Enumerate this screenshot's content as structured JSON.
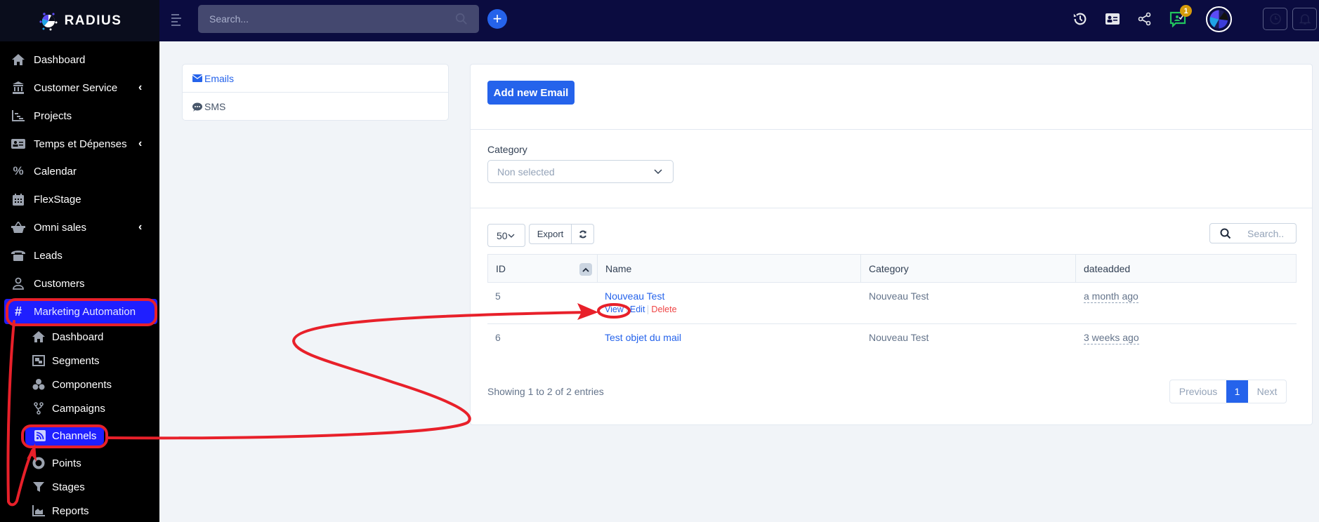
{
  "header": {
    "brand": "RADIUS",
    "search_placeholder": "Search...",
    "notification_count": "1",
    "icons": [
      "menu-toggle-icon",
      "search-icon",
      "plus-icon",
      "history-icon",
      "id-card-icon",
      "share-icon",
      "chat-check-icon",
      "avatar",
      "clock-icon",
      "bell-icon"
    ]
  },
  "sidebar": {
    "items": [
      {
        "label": "Dashboard",
        "icon": "home-icon"
      },
      {
        "label": "Customer Service",
        "icon": "bank-icon",
        "chevron": "‹"
      },
      {
        "label": "Projects",
        "icon": "chart-icon"
      },
      {
        "label": "Temps et Dépenses",
        "icon": "id-card-icon",
        "chevron": "‹"
      },
      {
        "label": "Calendar",
        "icon": "percent-icon"
      },
      {
        "label": "FlexStage",
        "icon": "calendar-icon"
      },
      {
        "label": "Omni sales",
        "icon": "basket-icon",
        "chevron": "‹"
      },
      {
        "label": "Leads",
        "icon": "phone-icon"
      },
      {
        "label": "Customers",
        "icon": "user-icon"
      },
      {
        "label": "Marketing Automation",
        "icon": "hashtag-icon",
        "active": true
      }
    ],
    "sub_items": [
      {
        "label": "Dashboard",
        "icon": "home-icon"
      },
      {
        "label": "Segments",
        "icon": "segments-icon"
      },
      {
        "label": "Components",
        "icon": "cubes-icon"
      },
      {
        "label": "Campaigns",
        "icon": "fork-icon"
      },
      {
        "label": "Channels",
        "icon": "rss-icon",
        "active": true
      },
      {
        "label": "Points",
        "icon": "circle-icon"
      },
      {
        "label": "Stages",
        "icon": "filter-icon"
      },
      {
        "label": "Reports",
        "icon": "area-chart-icon"
      }
    ]
  },
  "channels_menu": {
    "emails": "Emails",
    "sms": "SMS"
  },
  "main": {
    "add_button": "Add new Email",
    "category_label": "Category",
    "category_value": "Non selected",
    "page_length": "50",
    "export_label": "Export",
    "table_search_placeholder": "Search..",
    "columns": [
      "ID",
      "Name",
      "Category",
      "dateadded"
    ],
    "rows": [
      {
        "id": "5",
        "name": "Nouveau Test",
        "category": "Nouveau Test",
        "dateadded": "a month ago",
        "actions": [
          "View",
          "Edit",
          "Delete"
        ]
      },
      {
        "id": "6",
        "name": "Test objet du mail",
        "category": "Nouveau Test",
        "dateadded": "3 weeks ago"
      }
    ],
    "showing": "Showing 1 to 2 of 2 entries",
    "pagination": {
      "previous": "Previous",
      "current": "1",
      "next": "Next"
    }
  },
  "annotation_color": "#e8202a",
  "accent_color": "#2563eb",
  "active_nav_color": "#1f1fff"
}
